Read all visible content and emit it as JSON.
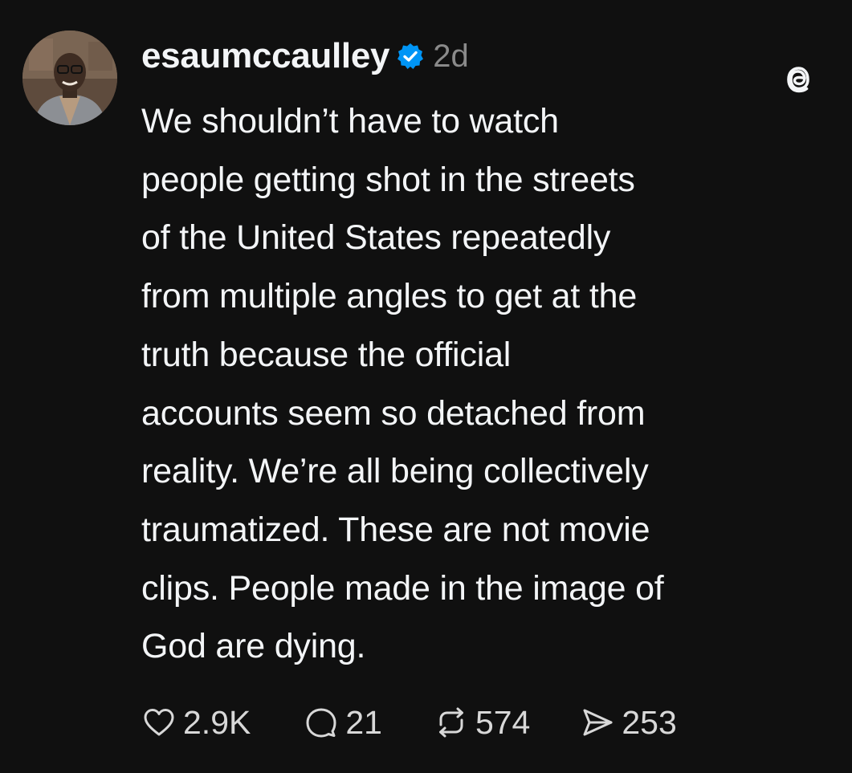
{
  "post": {
    "username": "esaumccaulley",
    "timestamp": "2d",
    "verified": true,
    "text_lines": [
      "We shouldn’t have to watch",
      "people getting shot in the streets",
      "of the United States repeatedly",
      "from multiple angles to get at the",
      "truth because the official",
      "accounts seem so detached from",
      "reality. We’re all being collectively",
      "traumatized. These are not movie",
      "clips. People made in the image of",
      "God are dying."
    ],
    "stats": {
      "likes": "2.9K",
      "replies": "21",
      "reposts": "574",
      "shares": "253"
    }
  },
  "colors": {
    "background": "#101010",
    "text": "#f3f5f7",
    "muted": "#8a8a8a",
    "verified_badge": "#0095f6"
  },
  "icons": {
    "verified": "verified-badge-icon",
    "app_logo": "threads-logo-icon",
    "like": "heart-icon",
    "reply": "comment-bubble-icon",
    "repost": "repost-arrows-icon",
    "share": "send-arrow-icon"
  }
}
